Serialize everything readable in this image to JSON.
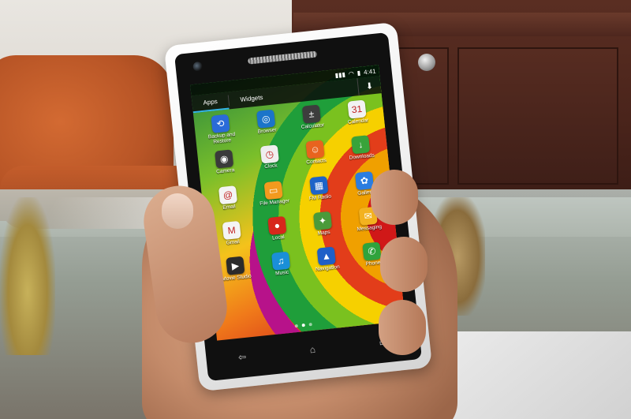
{
  "status_bar": {
    "time": "4:41",
    "wifi_icon": "wifi-icon",
    "signal_icon": "signal-icon",
    "battery_icon": "battery-icon"
  },
  "tabs": [
    {
      "label": "Apps",
      "active": true
    },
    {
      "label": "Widgets",
      "active": false
    }
  ],
  "store_icon": "play-store-icon",
  "apps": [
    {
      "label": "Backup and Restore",
      "icon": "backup-icon",
      "color": "#2a6bd8",
      "glyph": "⟲"
    },
    {
      "label": "Browser",
      "icon": "globe-icon",
      "color": "#1b74c9",
      "glyph": "◎"
    },
    {
      "label": "Calculator",
      "icon": "calculator-icon",
      "color": "#3d3d3d",
      "glyph": "±"
    },
    {
      "label": "Calendar",
      "icon": "calendar-icon",
      "color": "#f2f2f2",
      "glyph": "31"
    },
    {
      "label": "Camera",
      "icon": "camera-icon",
      "color": "#3a3a3a",
      "glyph": "◉"
    },
    {
      "label": "Clock",
      "icon": "clock-icon",
      "color": "#eeeeee",
      "glyph": "◷"
    },
    {
      "label": "Contacts",
      "icon": "contacts-icon",
      "color": "#e8631e",
      "glyph": "☺"
    },
    {
      "label": "Downloads",
      "icon": "downloads-icon",
      "color": "#38a33a",
      "glyph": "↓"
    },
    {
      "label": "Email",
      "icon": "email-icon",
      "color": "#f4f4f4",
      "glyph": "@"
    },
    {
      "label": "File Manager",
      "icon": "folder-icon",
      "color": "#f39a1e",
      "glyph": "▭"
    },
    {
      "label": "FM Radio",
      "icon": "radio-icon",
      "color": "#1e64c8",
      "glyph": "▦"
    },
    {
      "label": "Gallery",
      "icon": "gallery-icon",
      "color": "#2b7de0",
      "glyph": "✿"
    },
    {
      "label": "Gmail",
      "icon": "gmail-icon",
      "color": "#f4f4f4",
      "glyph": "M"
    },
    {
      "label": "Local",
      "icon": "map-pin-icon",
      "color": "#d7261b",
      "glyph": "●"
    },
    {
      "label": "Maps",
      "icon": "maps-icon",
      "color": "#4a9a3a",
      "glyph": "✦"
    },
    {
      "label": "Messaging",
      "icon": "messaging-icon",
      "color": "#f3b21f",
      "glyph": "✉"
    },
    {
      "label": "Movie Studio",
      "icon": "movie-studio-icon",
      "color": "#2b2b2b",
      "glyph": "▶"
    },
    {
      "label": "Music",
      "icon": "music-icon",
      "color": "#1a8fd8",
      "glyph": "♫"
    },
    {
      "label": "Navigation",
      "icon": "navigation-icon",
      "color": "#1e5fc8",
      "glyph": "▲"
    },
    {
      "label": "Phone",
      "icon": "phone-icon",
      "color": "#2fa33c",
      "glyph": "✆"
    }
  ],
  "page_indicator": {
    "count": 3,
    "active": 1
  },
  "nav_keys": [
    {
      "icon": "back-icon",
      "glyph": "⇦"
    },
    {
      "icon": "home-icon",
      "glyph": "⌂"
    },
    {
      "icon": "recent-apps-icon",
      "glyph": "▭"
    }
  ]
}
